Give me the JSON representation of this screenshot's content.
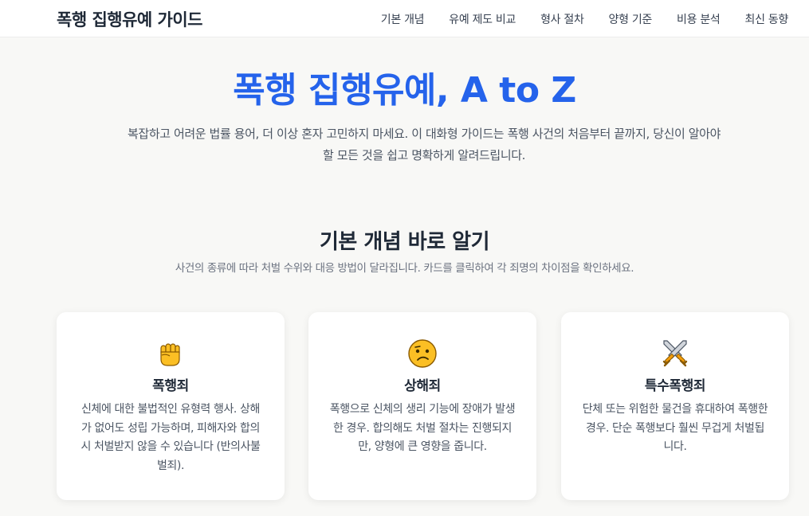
{
  "header": {
    "brand": "폭행 집행유예 가이드",
    "nav": [
      {
        "label": "기본 개념"
      },
      {
        "label": "유예 제도 비교"
      },
      {
        "label": "형사 절차"
      },
      {
        "label": "양형 기준"
      },
      {
        "label": "비용 분석"
      },
      {
        "label": "최신 동향"
      }
    ]
  },
  "hero": {
    "title": "폭행 집행유예, A to Z",
    "description": "복잡하고 어려운 법률 용어, 더 이상 혼자 고민하지 마세요. 이 대화형 가이드는 폭행 사건의 처음부터 끝까지, 당신이 알아야 할 모든 것을 쉽고 명확하게 알려드립니다."
  },
  "basics": {
    "title": "기본 개념 바로 알기",
    "description": "사건의 종류에 따라 처벌 수위와 대응 방법이 달라집니다. 카드를 클릭하여 각 죄명의 차이점을 확인하세요.",
    "cards": [
      {
        "icon": "raised-fist-icon",
        "title": "폭행죄",
        "description": "신체에 대한 불법적인 유형력 행사. 상해가 없어도 성립 가능하며, 피해자와 합의 시 처벌받지 않을 수 있습니다 (반의사불벌죄)."
      },
      {
        "icon": "confused-face-icon",
        "title": "상해죄",
        "description": "폭행으로 신체의 생리 기능에 장애가 발생한 경우. 합의해도 처벌 절차는 진행되지만, 양형에 큰 영향을 줍니다."
      },
      {
        "icon": "crossed-swords-icon",
        "title": "특수폭행죄",
        "description": "단체 또는 위험한 물건을 휴대하여 폭행한 경우. 단순 폭행보다 훨씬 무겁게 처벌됩니다."
      }
    ]
  },
  "colors": {
    "accent": "#2563eb",
    "background": "#f8f8f6",
    "card": "#ffffff",
    "text": "#1f2937",
    "muted": "#4b5563"
  }
}
